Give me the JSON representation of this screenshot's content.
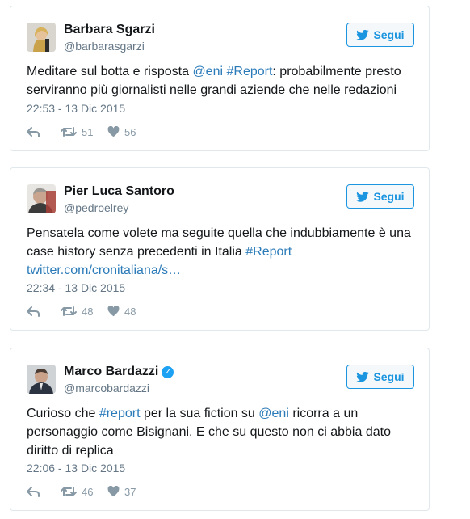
{
  "tweets": [
    {
      "name": "Barbara Sgarzi",
      "handle": "@barbarasgarzi",
      "verified": false,
      "follow": "Segui",
      "text": [
        {
          "t": "Meditare sul botta e risposta "
        },
        {
          "t": "@eni",
          "link": true
        },
        {
          "t": " "
        },
        {
          "t": "#Report",
          "link": true
        },
        {
          "t": ": probabilmente presto serviranno più giornalisti nelle grandi aziende che nelle redazioni"
        }
      ],
      "date": "22:53 - 13 Dic 2015",
      "retweets": "51",
      "likes": "56"
    },
    {
      "name": "Pier Luca Santoro",
      "handle": "@pedroelrey",
      "verified": false,
      "follow": "Segui",
      "text": [
        {
          "t": "Pensatela come volete ma seguite quella che indubbiamente è una case history senza precedenti in Italia "
        },
        {
          "t": "#Report",
          "link": true
        },
        {
          "t": " "
        },
        {
          "t": "twitter.com/cronitaliana/s…",
          "link": true
        }
      ],
      "date": "22:34 - 13 Dic 2015",
      "retweets": "48",
      "likes": "48"
    },
    {
      "name": "Marco Bardazzi",
      "handle": "@marcobardazzi",
      "verified": true,
      "follow": "Segui",
      "text": [
        {
          "t": "Curioso che "
        },
        {
          "t": "#report",
          "link": true
        },
        {
          "t": " per la sua fiction su "
        },
        {
          "t": "@eni",
          "link": true
        },
        {
          "t": " ricorra a un personaggio come Bisignani. E che su questo non ci abbia dato diritto di replica"
        }
      ],
      "date": "22:06 - 13 Dic 2015",
      "retweets": "46",
      "likes": "37"
    }
  ],
  "colors": {
    "link": "#2b7bb9",
    "follow": "#1b95e0",
    "muted": "#8899a6",
    "border": "#e1e8ed"
  },
  "icons": [
    "reply-icon",
    "retweet-icon",
    "heart-icon",
    "bird-icon",
    "verified-icon"
  ]
}
